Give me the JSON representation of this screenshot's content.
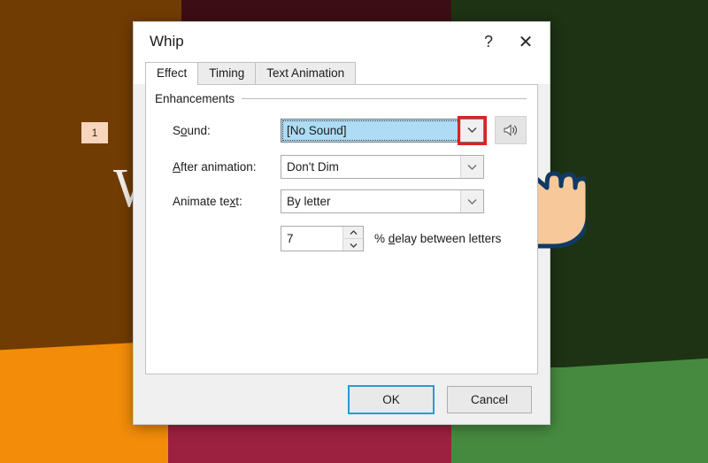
{
  "slide": {
    "number_badge": "1",
    "letter": "W",
    "colors": {
      "brown": "#713c04",
      "maroon": "#3c0d15",
      "dark_green": "#1d3314",
      "orange": "#f28c09",
      "crimson": "#9c2140",
      "green": "#468a3f",
      "badge_bg": "#f8d6bd"
    }
  },
  "dialog": {
    "title": "Whip",
    "help_icon": "question-mark-icon",
    "close_icon": "close-icon",
    "tabs": [
      {
        "label": "Effect",
        "active": true
      },
      {
        "label": "Timing",
        "active": false
      },
      {
        "label": "Text Animation",
        "active": false
      }
    ],
    "group": {
      "label": "Enhancements",
      "fields": [
        {
          "label_prefix": "S",
          "label_underlined": "o",
          "label_suffix": "und:",
          "value": "[No Sound]",
          "selected": true,
          "highlighted": true
        },
        {
          "label_prefix": "",
          "label_underlined": "A",
          "label_suffix": "fter animation:",
          "value": "Don't Dim",
          "selected": false,
          "highlighted": false
        },
        {
          "label_prefix": "Animate te",
          "label_underlined": "x",
          "label_suffix": "t:",
          "value": "By letter",
          "selected": false,
          "highlighted": false
        }
      ],
      "spinner": {
        "value": "7",
        "suffix_prefix": "% ",
        "suffix_underlined": "d",
        "suffix_rest": "elay between letters",
        "up_icon": "chevron-up-icon",
        "down_icon": "chevron-down-icon"
      },
      "sound_preview_icon": "speaker-icon",
      "highlight_color": "#e02020",
      "selection_color": "#addcf4"
    },
    "buttons": {
      "ok": "OK",
      "cancel": "Cancel",
      "focus_color": "#2a9bd6"
    }
  },
  "cursor": {
    "icon": "pointing-hand-cursor-icon",
    "fill": "#f7c89a",
    "stroke": "#0f3a63"
  }
}
